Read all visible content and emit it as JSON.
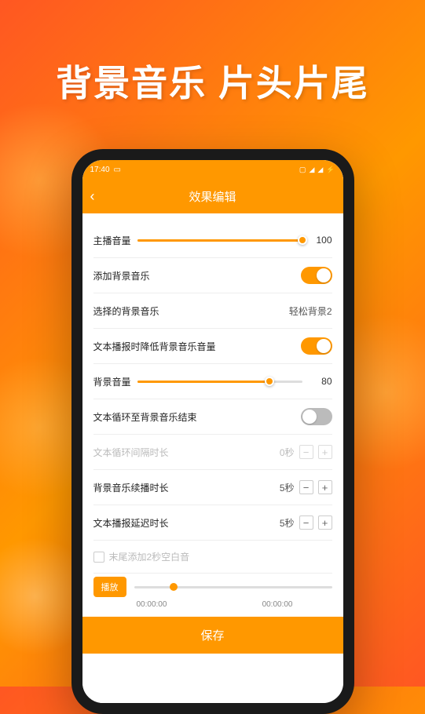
{
  "banner": "背景音乐 片头片尾",
  "statusbar": {
    "time": "17:40",
    "indicators": "▢ ◢ ▮"
  },
  "header": {
    "title": "效果编辑"
  },
  "rows": {
    "mainVolume": {
      "label": "主播音量",
      "value": "100",
      "percent": 100
    },
    "addBgm": {
      "label": "添加背景音乐"
    },
    "selectBgm": {
      "label": "选择的背景音乐",
      "value": "轻松背景2"
    },
    "lowerBgm": {
      "label": "文本播报时降低背景音乐音量"
    },
    "bgVolume": {
      "label": "背景音量",
      "value": "80",
      "percent": 80
    },
    "loop": {
      "label": "文本循环至背景音乐结束"
    },
    "loopInterval": {
      "label": "文本循环间隔时长",
      "value": "0秒"
    },
    "bgExtend": {
      "label": "背景音乐续播时长",
      "value": "5秒"
    },
    "textDelay": {
      "label": "文本播报延迟时长",
      "value": "5秒"
    },
    "addBlank": {
      "label": "末尾添加2秒空白音"
    }
  },
  "player": {
    "play": "播放",
    "start": "00:00:00",
    "end": "00:00:00"
  },
  "save": "保存"
}
